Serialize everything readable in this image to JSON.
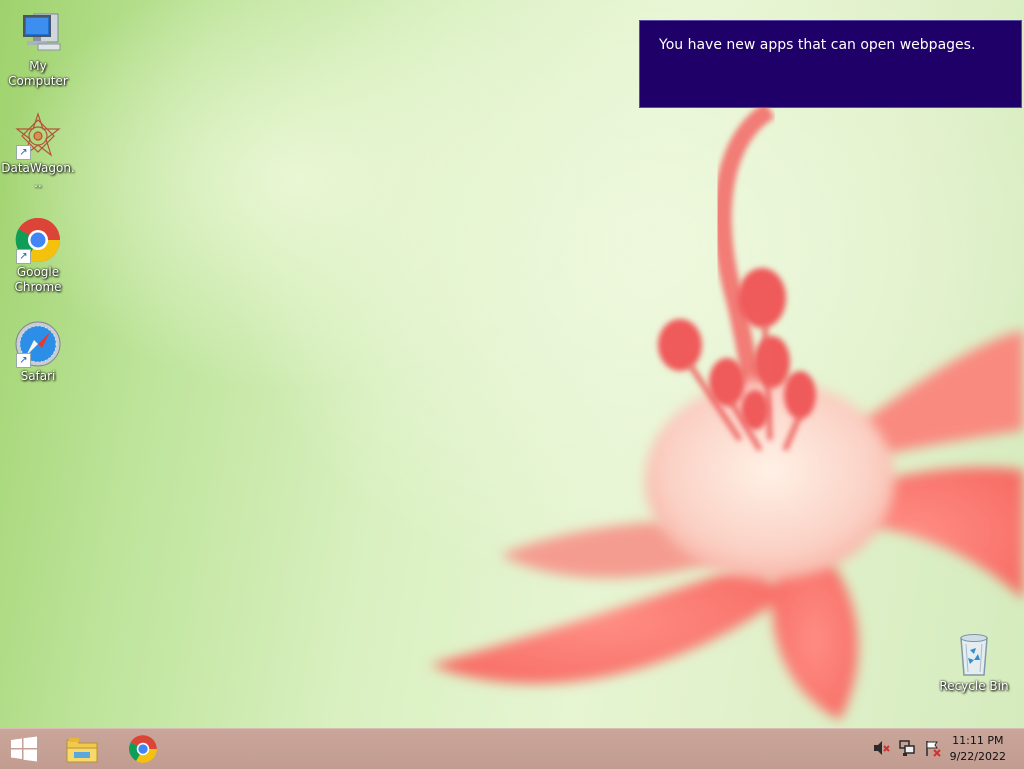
{
  "desktop_icons": [
    {
      "label": "My Computer",
      "icon": "computer-icon"
    },
    {
      "label": "DataWagon...",
      "icon": "datawagon-icon"
    },
    {
      "label": "Google Chrome",
      "icon": "chrome-icon"
    },
    {
      "label": "Safari",
      "icon": "safari-icon"
    },
    {
      "label": "Recycle Bin",
      "icon": "recycle-bin-icon"
    }
  ],
  "notification": {
    "text": "You have new apps that can open webpages."
  },
  "taskbar": {
    "pinned": [
      "start-icon",
      "file-explorer-icon",
      "chrome-icon"
    ],
    "tray": [
      "volume-muted-icon",
      "network-icon",
      "action-center-flag-icon"
    ],
    "clock": {
      "time": "11:11 PM",
      "date": "9/22/2022"
    }
  },
  "colors": {
    "notification_bg": "#1f0068",
    "taskbar_bg": "#c29c90"
  }
}
